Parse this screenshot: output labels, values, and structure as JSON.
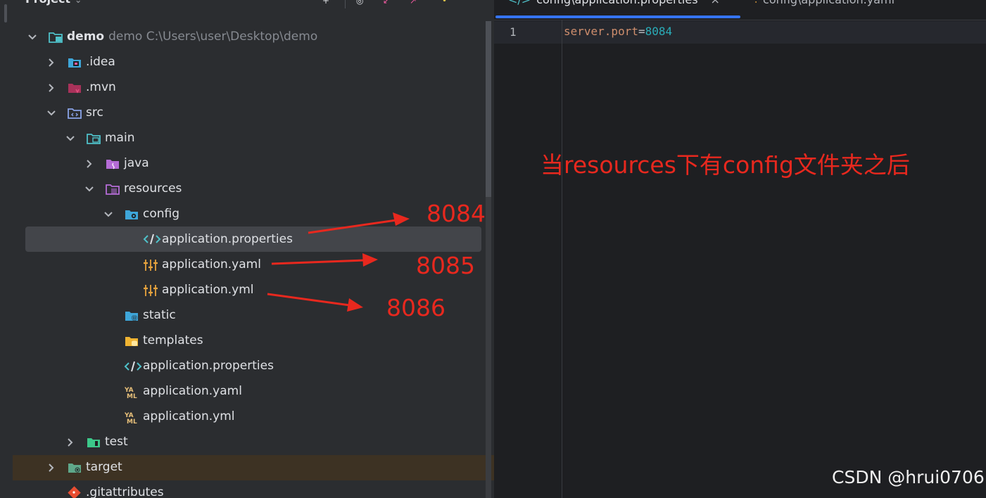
{
  "project_panel": {
    "title": "Project",
    "tree": [
      {
        "label": "demo",
        "muted": "demo  C:\\Users\\user\\Desktop\\demo"
      },
      {
        "label": ".idea"
      },
      {
        "label": ".mvn"
      },
      {
        "label": "src"
      },
      {
        "label": "main"
      },
      {
        "label": "java"
      },
      {
        "label": "resources"
      },
      {
        "label": "config"
      },
      {
        "label": "application.properties"
      },
      {
        "label": "application.yaml"
      },
      {
        "label": "application.yml"
      },
      {
        "label": "static"
      },
      {
        "label": "templates"
      },
      {
        "label": "application.properties"
      },
      {
        "label": "application.yaml"
      },
      {
        "label": "application.yml"
      },
      {
        "label": "test"
      },
      {
        "label": "target"
      },
      {
        "label": ".gitattributes"
      }
    ]
  },
  "editor": {
    "tabs": [
      {
        "label": "config\\application.properties",
        "close": "×"
      },
      {
        "label": "config\\application.yaml"
      }
    ],
    "lines": [
      {
        "number": "1",
        "key": "server.port",
        "eq": "=",
        "value": "8084"
      }
    ]
  },
  "annotations": {
    "heading": "当resources下有config文件夹之后",
    "labels": [
      "8084",
      "8085",
      "8086"
    ]
  },
  "watermark": "CSDN @hrui0706",
  "colors": {
    "annotation": "#e8281e",
    "accent": "#3574f0",
    "panel_bg": "#2b2d30",
    "editor_bg": "#1e1f22"
  }
}
